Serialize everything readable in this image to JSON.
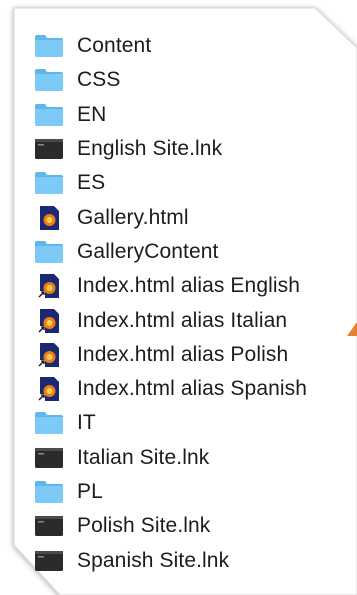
{
  "colors": {
    "folder_front": "#7ccaf5",
    "folder_back": "#5fb6ea",
    "terminal": "#2b2b2b",
    "html_doc": "#1a2a72",
    "browser_orange": "#f27b12",
    "accent": "#e8802a"
  },
  "files": [
    {
      "name": "Content",
      "icon": "folder-icon"
    },
    {
      "name": "CSS",
      "icon": "folder-icon"
    },
    {
      "name": "EN",
      "icon": "folder-icon"
    },
    {
      "name": "English Site.lnk",
      "icon": "terminal-shortcut-icon"
    },
    {
      "name": "ES",
      "icon": "folder-icon"
    },
    {
      "name": "Gallery.html",
      "icon": "html-document-icon"
    },
    {
      "name": "GalleryContent",
      "icon": "folder-icon"
    },
    {
      "name": "Index.html alias English",
      "icon": "html-alias-icon"
    },
    {
      "name": "Index.html alias Italian",
      "icon": "html-alias-icon"
    },
    {
      "name": "Index.html alias Polish",
      "icon": "html-alias-icon"
    },
    {
      "name": "Index.html alias Spanish",
      "icon": "html-alias-icon"
    },
    {
      "name": "IT",
      "icon": "folder-icon"
    },
    {
      "name": "Italian Site.lnk",
      "icon": "terminal-shortcut-icon"
    },
    {
      "name": "PL",
      "icon": "folder-icon"
    },
    {
      "name": "Polish Site.lnk",
      "icon": "terminal-shortcut-icon"
    },
    {
      "name": "Spanish Site.lnk",
      "icon": "terminal-shortcut-icon"
    }
  ]
}
